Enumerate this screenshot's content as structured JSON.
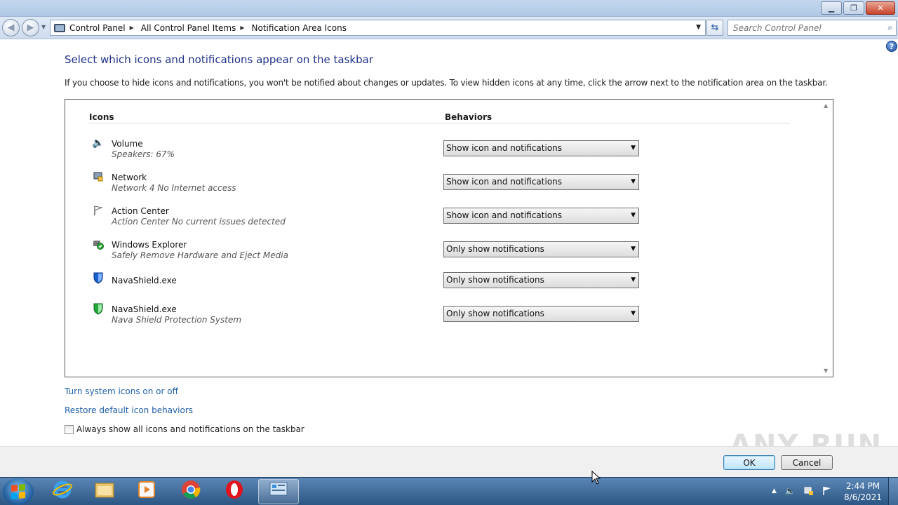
{
  "window": {
    "minimize": "▁",
    "restore": "❐",
    "close": "✕"
  },
  "nav": {
    "back_icon": "◀",
    "forward_icon": "▶",
    "breadcrumbs": [
      "Control Panel",
      "All Control Panel Items",
      "Notification Area Icons"
    ],
    "search_placeholder": "Search Control Panel",
    "refresh_icon": "⇆",
    "help_icon": "?"
  },
  "content": {
    "heading": "Select which icons and notifications appear on the taskbar",
    "intro": "If you choose to hide icons and notifications, you won't be notified about changes or updates. To view hidden icons at any time, click the arrow next to the notification area on the taskbar.",
    "col_icons": "Icons",
    "col_behaviors": "Behaviors",
    "rows": [
      {
        "icon": "speaker-icon",
        "name": "Volume",
        "desc": "Speakers: 67%",
        "behavior": "Show icon and notifications"
      },
      {
        "icon": "network-icon",
        "name": "Network",
        "desc": "Network  4 No Internet access",
        "behavior": "Show icon and notifications"
      },
      {
        "icon": "flag-icon",
        "name": "Action Center",
        "desc": "Action Center  No current issues detected",
        "behavior": "Show icon and notifications"
      },
      {
        "icon": "safely-remove-icon",
        "name": "Windows Explorer",
        "desc": "Safely Remove Hardware and Eject Media",
        "behavior": "Only show notifications"
      },
      {
        "icon": "blue-shield-icon",
        "name": "NavaShield.exe",
        "desc": "",
        "behavior": "Only show notifications"
      },
      {
        "icon": "green-shield-icon",
        "name": "NavaShield.exe",
        "desc": "Nava Shield Protection System",
        "behavior": "Only show notifications"
      }
    ],
    "link_system_icons": "Turn system icons on or off",
    "link_restore": "Restore default icon behaviors",
    "checkbox_label": "Always show all icons and notifications on the taskbar",
    "checkbox_checked": false
  },
  "footer": {
    "ok": "OK",
    "cancel": "Cancel"
  },
  "watermark": "ANY RUN",
  "taskbar": {
    "time": "2:44 PM",
    "date": "8/6/2021",
    "tray_arrow": "▲",
    "accent": "#2c5683"
  }
}
